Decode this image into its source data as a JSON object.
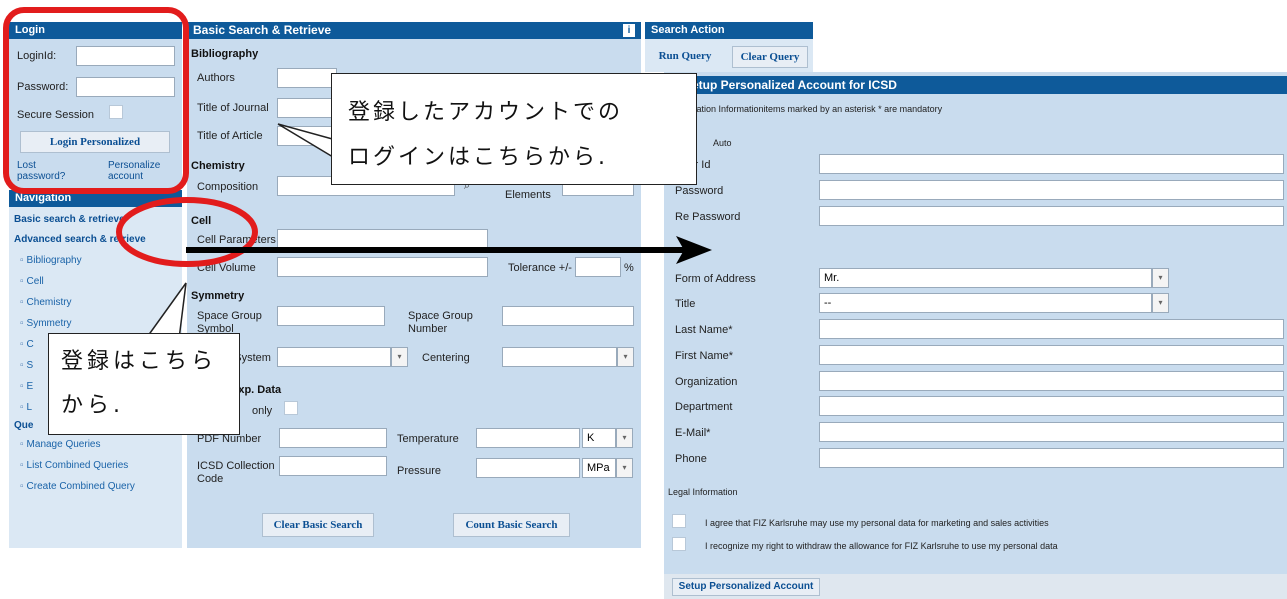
{
  "login": {
    "header": "Login",
    "loginid_label": "LoginId:",
    "password_label": "Password:",
    "secure_label": "Secure Session",
    "login_button": "Login Personalized",
    "lost_link": "Lost password?",
    "personalize_link": "Personalize account"
  },
  "navigation": {
    "header": "Navigation",
    "basic": "Basic search & retrieve",
    "advanced": "Advanced search & retrieve",
    "items": [
      "Bibliography",
      "Cell",
      "Chemistry",
      "Symmetry",
      "C",
      "S",
      "E",
      "L"
    ],
    "queries_header": "Que",
    "query_items": [
      "Manage Queries",
      "List Combined Queries",
      "Create Combined Query"
    ]
  },
  "basic": {
    "header": "Basic Search & Retrieve",
    "bibliography": "Bibliography",
    "authors": "Authors",
    "title_journal": "Title of Journal",
    "title_article": "Title of Article",
    "chemistry": "Chemistry",
    "composition": "Composition",
    "number_elements": "Number of Elements",
    "cell": "Cell",
    "cell_params": "Cell Parameters",
    "cell_volume": "Cell Volume",
    "tolerance": "Tolerance",
    "tolerance_sign": "+/-",
    "percent": "%",
    "symmetry": "Symmetry",
    "space_group_symbol": "Space Group Symbol",
    "space_group_number": "Space Group Number",
    "crystal_system": "Crystal System",
    "centering": "Centering",
    "exp_data": "Exp. Data",
    "only": "only",
    "pdf_number": "PDF Number",
    "temperature": "Temperature",
    "temp_unit": "K",
    "icsd_code": "ICSD Collection Code",
    "pressure": "Pressure",
    "pressure_unit": "MPa",
    "clear_button": "Clear Basic Search",
    "count_button": "Count Basic Search"
  },
  "search_action": {
    "header": "Search Action",
    "run": "Run Query",
    "clear": "Clear Query"
  },
  "setup": {
    "header": "Setup Personalized Account for ICSD",
    "note": "Registration Informationitems marked by an asterisk * are mandatory",
    "auto_label": "Auto",
    "fields": [
      "User Id",
      "Password",
      "Re Password"
    ],
    "form_of_address_label": "Form of Address",
    "form_of_address_value": "Mr.",
    "title_label": "Title",
    "title_value": "--",
    "fields2": [
      "Last Name*",
      "First Name*",
      "Organization",
      "Department",
      "E-Mail*",
      "Phone"
    ],
    "legal": "Legal Information",
    "agree1": "I agree that FIZ Karlsruhe may use my personal data for marketing and sales activities",
    "agree2": "I recognize my right to withdraw the allowance for FIZ Karlsruhe to use my personal data",
    "submit": "Setup Personalized Account"
  },
  "callouts": {
    "login_line1": "登録したアカウントでの",
    "login_line2": "ログインはこちらから.",
    "register_line1": "登録はこちら",
    "register_line2": "から."
  },
  "colors": {
    "header_bg": "#0e5a9a",
    "panel_bg": "#c9dcee",
    "annotation_red": "#e21c1c"
  }
}
